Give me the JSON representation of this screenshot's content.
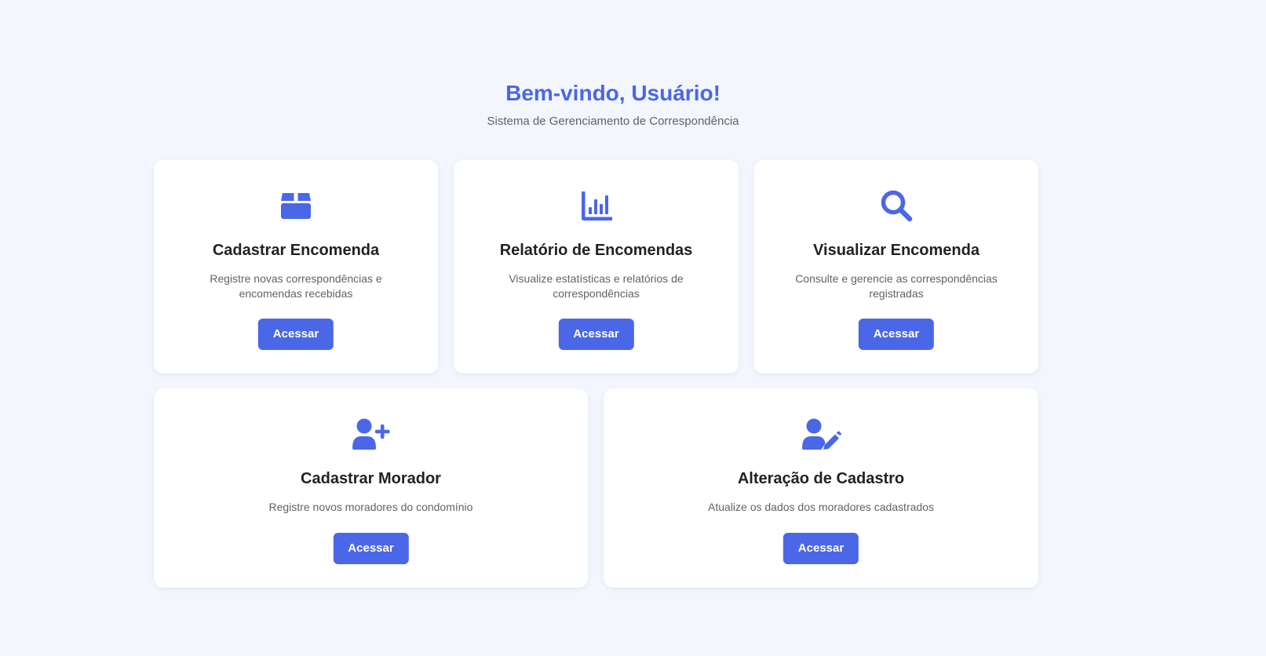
{
  "header": {
    "title": "Bem-vindo, Usuário!",
    "subtitle": "Sistema de Gerenciamento de Correspondência"
  },
  "theme": {
    "accent": "#4a67e8",
    "background": "#f3f6fd",
    "card": "#ffffff"
  },
  "cards": [
    {
      "icon": "box-icon",
      "title": "Cadastrar Encomenda",
      "description": "Registre novas correspondências e encomendas recebidas",
      "button": "Acessar"
    },
    {
      "icon": "bar-chart-icon",
      "title": "Relatório de Encomendas",
      "description": "Visualize estatísticas e relatórios de correspondências",
      "button": "Acessar"
    },
    {
      "icon": "search-icon",
      "title": "Visualizar Encomenda",
      "description": "Consulte e gerencie as correspondências registradas",
      "button": "Acessar"
    },
    {
      "icon": "user-plus-icon",
      "title": "Cadastrar Morador",
      "description": "Registre novos moradores do condomínio",
      "button": "Acessar"
    },
    {
      "icon": "user-edit-icon",
      "title": "Alteração de Cadastro",
      "description": "Atualize os dados dos moradores cadastrados",
      "button": "Acessar"
    }
  ]
}
